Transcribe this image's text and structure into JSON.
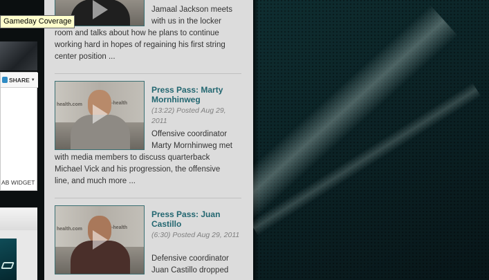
{
  "tooltip": {
    "text": "Gameday Coverage"
  },
  "left_widget": {
    "share_label": "SHARE",
    "grab_widget_label": "AB WIDGET"
  },
  "videos": [
    {
      "title": "",
      "meta": "",
      "description_lines": [
        "Jamaal Jackson meets",
        "with us in the locker",
        "room and talks about how he plans to continue",
        "working hard in hopes of regaining his first string",
        "center position ..."
      ]
    },
    {
      "title": "Press Pass: Marty Mornhinweg",
      "meta": "(13:22) Posted Aug 29, 2011",
      "description_lines": [
        "Offensive coordinator",
        "Marty Mornhinweg met",
        "with media members to discuss quarterback",
        "Michael Vick and his progression, the offensive",
        "line, and much more ..."
      ],
      "thumb_wall_text": [
        "health.com",
        "smart-health"
      ]
    },
    {
      "title": "Press Pass: Juan Castillo",
      "meta": "(6:30) Posted Aug 29, 2011",
      "description_lines": [
        "Defensive coordinator",
        "Juan Castillo dropped"
      ],
      "thumb_wall_text": [
        "health.com",
        "smart-health"
      ]
    }
  ],
  "colors": {
    "title": "#226670",
    "column_bg": "#dcdcdc",
    "page_bg": "#0c2427"
  }
}
